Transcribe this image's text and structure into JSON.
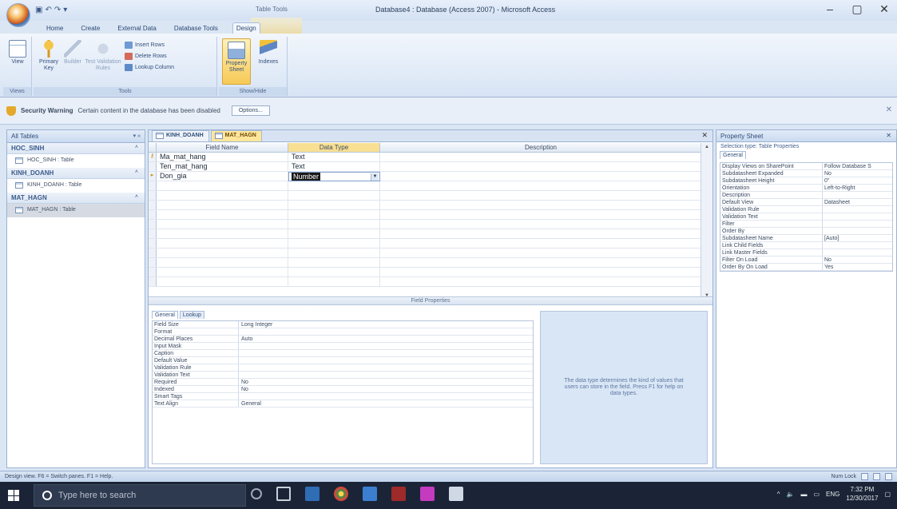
{
  "window": {
    "title": "Database4 : Database (Access 2007) - Microsoft Access",
    "context_label": "Table Tools",
    "controls": [
      "–",
      "▢",
      "✕"
    ]
  },
  "ribbon": {
    "tabs": [
      "Home",
      "Create",
      "External Data",
      "Database Tools",
      "Design"
    ],
    "active_tab": "Design",
    "groups": {
      "views": {
        "label": "Views",
        "view_button": "View"
      },
      "tools": {
        "label": "Tools",
        "primary_key": "Primary Key",
        "builder": "Builder",
        "test_validation": "Test Validation Rules",
        "insert_rows": "Insert Rows",
        "delete_rows": "Delete Rows",
        "lookup_column": "Lookup Column"
      },
      "show_hide": {
        "label": "Show/Hide",
        "property_sheet": "Property Sheet",
        "indexes": "Indexes"
      }
    }
  },
  "security_bar": {
    "title": "Security Warning",
    "message": "Certain content in the database has been disabled",
    "options_button": "Options..."
  },
  "nav_pane": {
    "header": "All Tables",
    "groups": [
      {
        "name": "HOC_SINH",
        "item": "HOC_SINH : Table"
      },
      {
        "name": "KINH_DOANH",
        "item": "KINH_DOANH : Table"
      },
      {
        "name": "MAT_HAGN",
        "item": "MAT_HAGN : Table"
      }
    ]
  },
  "document": {
    "tabs": [
      "KINH_DOANH",
      "MAT_HAGN"
    ],
    "active_tab": "MAT_HAGN",
    "columns": {
      "field_name": "Field Name",
      "data_type": "Data Type",
      "description": "Description"
    },
    "fields": [
      {
        "name": "Ma_mat_hang",
        "type": "Text",
        "key": true
      },
      {
        "name": "Ten_mat_hang",
        "type": "Text",
        "key": false
      },
      {
        "name": "Don_gia",
        "type": "Number",
        "key": false,
        "editing": true
      }
    ],
    "field_properties_label": "Field Properties",
    "fp_tabs": [
      "General",
      "Lookup"
    ],
    "fp_rows": [
      {
        "k": "Field Size",
        "v": "Long Integer"
      },
      {
        "k": "Format",
        "v": ""
      },
      {
        "k": "Decimal Places",
        "v": "Auto"
      },
      {
        "k": "Input Mask",
        "v": ""
      },
      {
        "k": "Caption",
        "v": ""
      },
      {
        "k": "Default Value",
        "v": ""
      },
      {
        "k": "Validation Rule",
        "v": ""
      },
      {
        "k": "Validation Text",
        "v": ""
      },
      {
        "k": "Required",
        "v": "No"
      },
      {
        "k": "Indexed",
        "v": "No"
      },
      {
        "k": "Smart Tags",
        "v": ""
      },
      {
        "k": "Text Align",
        "v": "General"
      }
    ],
    "help_text": "The data type determines the kind of values that users can store in the field. Press F1 for help on data types."
  },
  "property_sheet": {
    "title": "Property Sheet",
    "selection_type": "Selection type: Table Properties",
    "tab": "General",
    "rows": [
      {
        "k": "Display Views on SharePoint",
        "v": "Follow Database S"
      },
      {
        "k": "Subdatasheet Expanded",
        "v": "No"
      },
      {
        "k": "Subdatasheet Height",
        "v": "0\""
      },
      {
        "k": "Orientation",
        "v": "Left-to-Right"
      },
      {
        "k": "Description",
        "v": ""
      },
      {
        "k": "Default View",
        "v": "Datasheet"
      },
      {
        "k": "Validation Rule",
        "v": ""
      },
      {
        "k": "Validation Text",
        "v": ""
      },
      {
        "k": "Filter",
        "v": ""
      },
      {
        "k": "Order By",
        "v": ""
      },
      {
        "k": "Subdatasheet Name",
        "v": "[Auto]"
      },
      {
        "k": "Link Child Fields",
        "v": ""
      },
      {
        "k": "Link Master Fields",
        "v": ""
      },
      {
        "k": "Filter On Load",
        "v": "No"
      },
      {
        "k": "Order By On Load",
        "v": "Yes"
      }
    ]
  },
  "status_bar": {
    "left": "Design view. F6 = Switch panes. F1 = Help.",
    "right": "Num Lock"
  },
  "taskbar": {
    "search_placeholder": "Type here to search",
    "language": "ENG",
    "time": "7:32 PM",
    "date": "12/30/2017"
  },
  "colors": {
    "accent": "#f8df92",
    "taskbar": "#1b2436"
  }
}
